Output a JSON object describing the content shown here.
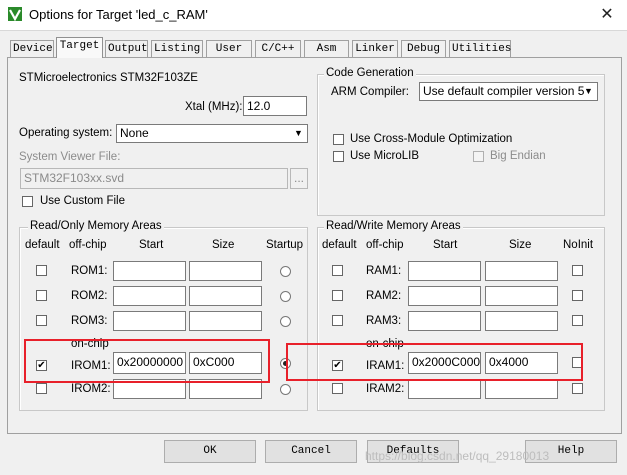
{
  "window": {
    "title": "Options for Target 'led_c_RAM'",
    "close_glyph": "✕"
  },
  "tabs": [
    "Device",
    "Target",
    "Output",
    "Listing",
    "User",
    "C/C++",
    "Asm",
    "Linker",
    "Debug",
    "Utilities"
  ],
  "active_tab": "Target",
  "device": {
    "name": "STMicroelectronics STM32F103ZE",
    "xtal_label": "Xtal (MHz):",
    "xtal_value": "12.0",
    "os_label": "Operating system:",
    "os_value": "None",
    "svd_label": "System Viewer File:",
    "svd_value": "STM32F103xx.svd",
    "browse_label": "...",
    "custom_file_label": "Use Custom File"
  },
  "code_generation": {
    "title": "Code Generation",
    "compiler_label": "ARM Compiler:",
    "compiler_value": "Use default compiler version 5",
    "cross_module_label": "Use Cross-Module Optimization",
    "microlib_label": "Use MicroLIB",
    "big_endian_label": "Big Endian"
  },
  "rom": {
    "title": "Read/Only Memory Areas",
    "headers": {
      "default": "default",
      "offchip": "off-chip",
      "start": "Start",
      "size": "Size",
      "startup": "Startup"
    },
    "onchip_label": "on-chip",
    "rows": [
      {
        "name": "ROM1:",
        "start": "",
        "size": "",
        "default": false,
        "startup": false
      },
      {
        "name": "ROM2:",
        "start": "",
        "size": "",
        "default": false,
        "startup": false
      },
      {
        "name": "ROM3:",
        "start": "",
        "size": "",
        "default": false,
        "startup": false
      },
      {
        "name": "IROM1:",
        "start": "0x20000000",
        "size": "0xC000",
        "default": true,
        "startup": true
      },
      {
        "name": "IROM2:",
        "start": "",
        "size": "",
        "default": false,
        "startup": false
      }
    ]
  },
  "ram": {
    "title": "Read/Write Memory Areas",
    "headers": {
      "default": "default",
      "offchip": "off-chip",
      "start": "Start",
      "size": "Size",
      "noinit": "NoInit"
    },
    "onchip_label": "on-chip",
    "rows": [
      {
        "name": "RAM1:",
        "start": "",
        "size": ""
      },
      {
        "name": "RAM2:",
        "start": "",
        "size": ""
      },
      {
        "name": "RAM3:",
        "start": "",
        "size": ""
      },
      {
        "name": "IRAM1:",
        "start": "0x2000C000",
        "size": "0x4000",
        "default": true
      },
      {
        "name": "IRAM2:",
        "start": "",
        "size": ""
      }
    ]
  },
  "buttons": {
    "ok": "OK",
    "cancel": "Cancel",
    "defaults": "Defaults",
    "help": "Help"
  },
  "watermark": "https://blog.csdn.net/qq_29180013",
  "colors": {
    "highlight_box": "#e8202a",
    "app_icon": "#2a8a2a"
  }
}
